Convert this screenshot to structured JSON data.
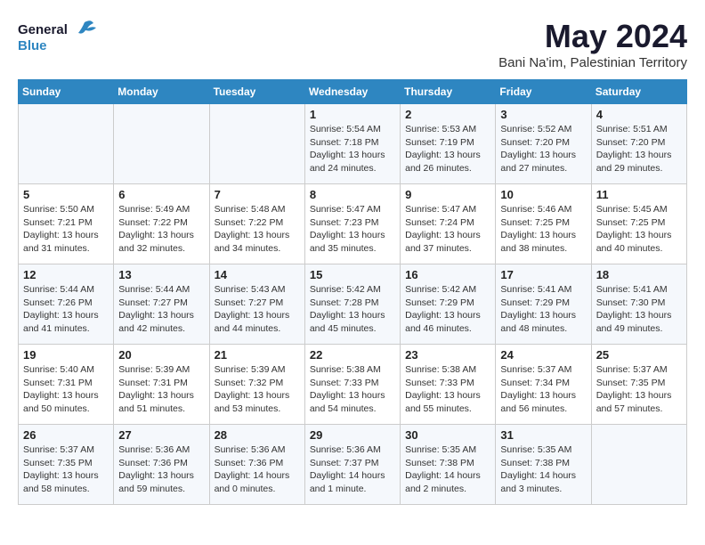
{
  "header": {
    "logo_line1": "General",
    "logo_line2": "Blue",
    "month": "May 2024",
    "location": "Bani Na'im, Palestinian Territory"
  },
  "weekdays": [
    "Sunday",
    "Monday",
    "Tuesday",
    "Wednesday",
    "Thursday",
    "Friday",
    "Saturday"
  ],
  "weeks": [
    [
      {
        "day": "",
        "content": ""
      },
      {
        "day": "",
        "content": ""
      },
      {
        "day": "",
        "content": ""
      },
      {
        "day": "1",
        "content": "Sunrise: 5:54 AM\nSunset: 7:18 PM\nDaylight: 13 hours\nand 24 minutes."
      },
      {
        "day": "2",
        "content": "Sunrise: 5:53 AM\nSunset: 7:19 PM\nDaylight: 13 hours\nand 26 minutes."
      },
      {
        "day": "3",
        "content": "Sunrise: 5:52 AM\nSunset: 7:20 PM\nDaylight: 13 hours\nand 27 minutes."
      },
      {
        "day": "4",
        "content": "Sunrise: 5:51 AM\nSunset: 7:20 PM\nDaylight: 13 hours\nand 29 minutes."
      }
    ],
    [
      {
        "day": "5",
        "content": "Sunrise: 5:50 AM\nSunset: 7:21 PM\nDaylight: 13 hours\nand 31 minutes."
      },
      {
        "day": "6",
        "content": "Sunrise: 5:49 AM\nSunset: 7:22 PM\nDaylight: 13 hours\nand 32 minutes."
      },
      {
        "day": "7",
        "content": "Sunrise: 5:48 AM\nSunset: 7:22 PM\nDaylight: 13 hours\nand 34 minutes."
      },
      {
        "day": "8",
        "content": "Sunrise: 5:47 AM\nSunset: 7:23 PM\nDaylight: 13 hours\nand 35 minutes."
      },
      {
        "day": "9",
        "content": "Sunrise: 5:47 AM\nSunset: 7:24 PM\nDaylight: 13 hours\nand 37 minutes."
      },
      {
        "day": "10",
        "content": "Sunrise: 5:46 AM\nSunset: 7:25 PM\nDaylight: 13 hours\nand 38 minutes."
      },
      {
        "day": "11",
        "content": "Sunrise: 5:45 AM\nSunset: 7:25 PM\nDaylight: 13 hours\nand 40 minutes."
      }
    ],
    [
      {
        "day": "12",
        "content": "Sunrise: 5:44 AM\nSunset: 7:26 PM\nDaylight: 13 hours\nand 41 minutes."
      },
      {
        "day": "13",
        "content": "Sunrise: 5:44 AM\nSunset: 7:27 PM\nDaylight: 13 hours\nand 42 minutes."
      },
      {
        "day": "14",
        "content": "Sunrise: 5:43 AM\nSunset: 7:27 PM\nDaylight: 13 hours\nand 44 minutes."
      },
      {
        "day": "15",
        "content": "Sunrise: 5:42 AM\nSunset: 7:28 PM\nDaylight: 13 hours\nand 45 minutes."
      },
      {
        "day": "16",
        "content": "Sunrise: 5:42 AM\nSunset: 7:29 PM\nDaylight: 13 hours\nand 46 minutes."
      },
      {
        "day": "17",
        "content": "Sunrise: 5:41 AM\nSunset: 7:29 PM\nDaylight: 13 hours\nand 48 minutes."
      },
      {
        "day": "18",
        "content": "Sunrise: 5:41 AM\nSunset: 7:30 PM\nDaylight: 13 hours\nand 49 minutes."
      }
    ],
    [
      {
        "day": "19",
        "content": "Sunrise: 5:40 AM\nSunset: 7:31 PM\nDaylight: 13 hours\nand 50 minutes."
      },
      {
        "day": "20",
        "content": "Sunrise: 5:39 AM\nSunset: 7:31 PM\nDaylight: 13 hours\nand 51 minutes."
      },
      {
        "day": "21",
        "content": "Sunrise: 5:39 AM\nSunset: 7:32 PM\nDaylight: 13 hours\nand 53 minutes."
      },
      {
        "day": "22",
        "content": "Sunrise: 5:38 AM\nSunset: 7:33 PM\nDaylight: 13 hours\nand 54 minutes."
      },
      {
        "day": "23",
        "content": "Sunrise: 5:38 AM\nSunset: 7:33 PM\nDaylight: 13 hours\nand 55 minutes."
      },
      {
        "day": "24",
        "content": "Sunrise: 5:37 AM\nSunset: 7:34 PM\nDaylight: 13 hours\nand 56 minutes."
      },
      {
        "day": "25",
        "content": "Sunrise: 5:37 AM\nSunset: 7:35 PM\nDaylight: 13 hours\nand 57 minutes."
      }
    ],
    [
      {
        "day": "26",
        "content": "Sunrise: 5:37 AM\nSunset: 7:35 PM\nDaylight: 13 hours\nand 58 minutes."
      },
      {
        "day": "27",
        "content": "Sunrise: 5:36 AM\nSunset: 7:36 PM\nDaylight: 13 hours\nand 59 minutes."
      },
      {
        "day": "28",
        "content": "Sunrise: 5:36 AM\nSunset: 7:36 PM\nDaylight: 14 hours\nand 0 minutes."
      },
      {
        "day": "29",
        "content": "Sunrise: 5:36 AM\nSunset: 7:37 PM\nDaylight: 14 hours\nand 1 minute."
      },
      {
        "day": "30",
        "content": "Sunrise: 5:35 AM\nSunset: 7:38 PM\nDaylight: 14 hours\nand 2 minutes."
      },
      {
        "day": "31",
        "content": "Sunrise: 5:35 AM\nSunset: 7:38 PM\nDaylight: 14 hours\nand 3 minutes."
      },
      {
        "day": "",
        "content": ""
      }
    ]
  ]
}
